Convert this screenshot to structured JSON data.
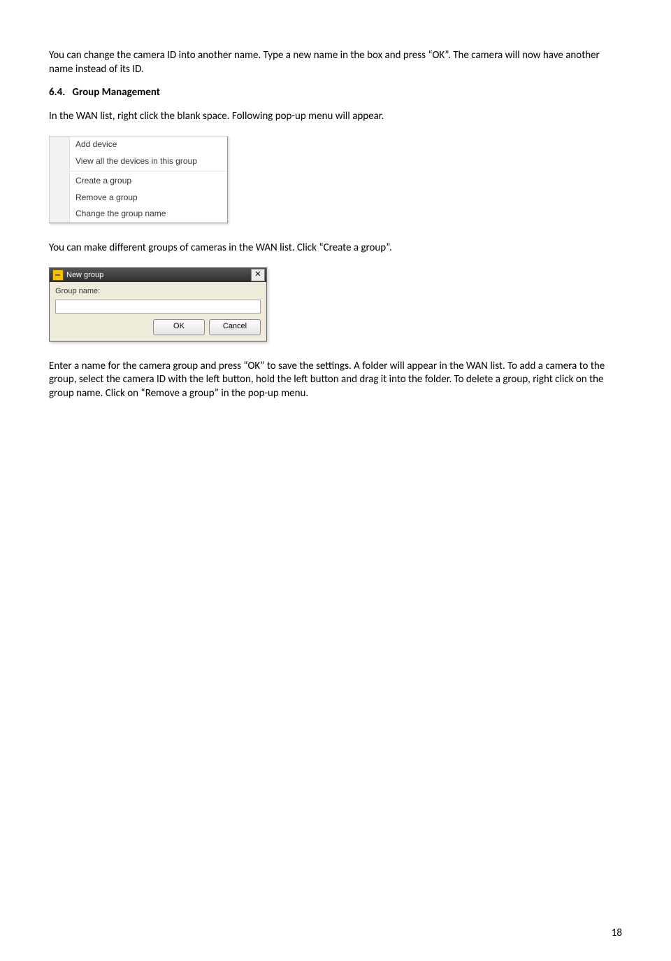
{
  "para1": "You can change the camera ID into another name. Type a new name in the box and press “OK”. The camera will now have another name instead of its ID.",
  "section_num": "6.4.",
  "section_title": "Group Management",
  "para2": "In the WAN list, right click the blank space. Following pop-up menu will appear.",
  "ctxmenu": {
    "items": [
      "Add device",
      "View all the devices in this group",
      "Create a group",
      "Remove a group",
      "Change the group name"
    ]
  },
  "para3": "You can make different groups of cameras in the WAN list. Click “Create a group”.",
  "dialog": {
    "title": "New group",
    "label": "Group name:",
    "value": "",
    "ok": "OK",
    "cancel": "Cancel",
    "close": "✕"
  },
  "para4": "Enter a name for the camera group and press “OK” to save the settings. A folder will appear in the WAN list. To add a camera to the group, select the camera ID with the left button, hold the left button and drag it into the folder. To delete a group, right click on the group name. Click on “Remove a group” in the pop-up menu.",
  "page_number": "18"
}
